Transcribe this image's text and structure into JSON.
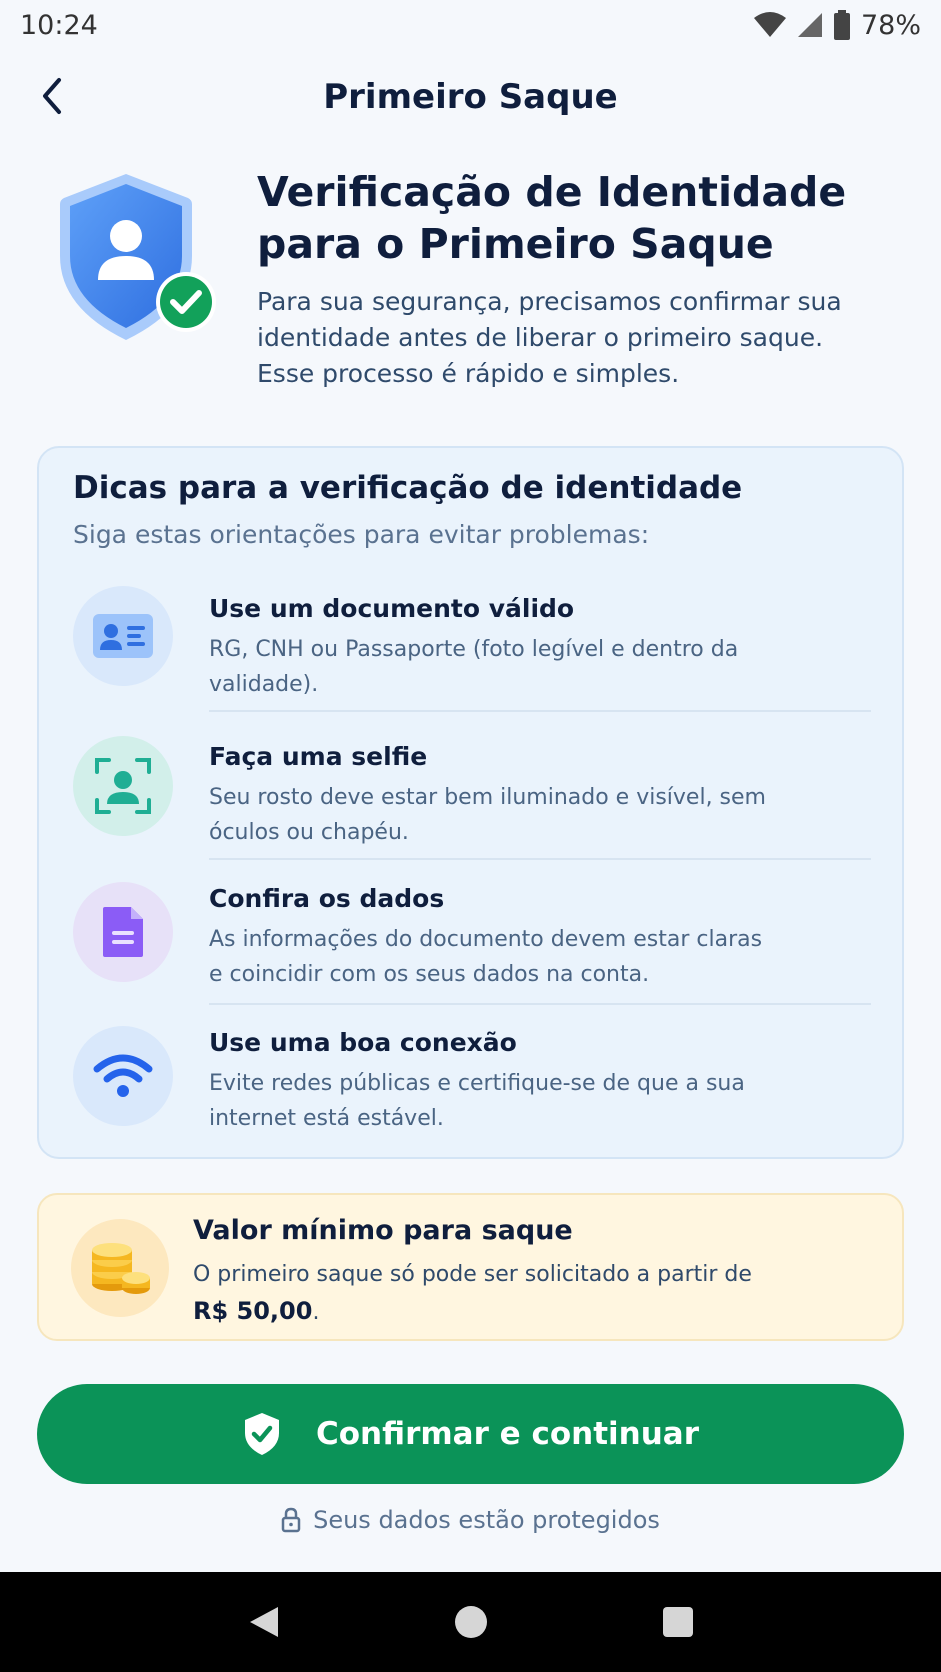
{
  "status_bar": {
    "time": "10:24",
    "battery": "78%"
  },
  "header": {
    "title": "Primeiro Saque"
  },
  "hero": {
    "title": "Verificação de Identidade para o Primeiro Saque",
    "description": "Para sua segurança, precisamos confirmar sua identidade antes de liberar o primeiro saque. Esse processo é rápido e simples."
  },
  "tips": {
    "title": "Dicas para a verificação de identidade",
    "subtitle": "Siga estas orientações para evitar problemas:",
    "items": [
      {
        "title": "Use um documento válido",
        "description": "RG, CNH ou Passaporte (foto legível e dentro da validade).",
        "icon": "id-card-icon",
        "color": "#3b82f6"
      },
      {
        "title": "Faça uma selfie",
        "description": "Seu rosto deve estar bem iluminado e visível, sem óculos ou chapéu.",
        "icon": "selfie-icon",
        "color": "#14b8a6"
      },
      {
        "title": "Confira os dados",
        "description": "As informações do documento devem estar claras e coincidir com os seus dados na conta.",
        "icon": "document-icon",
        "color": "#8b5cf6"
      },
      {
        "title": "Use uma boa conexão",
        "description": "Evite redes públicas e certifique-se de que a sua internet está estável.",
        "icon": "wifi-icon",
        "color": "#2563eb"
      }
    ]
  },
  "minimum": {
    "title": "Valor mínimo para saque",
    "description": "O primeiro saque só pode ser solicitado a partir de",
    "amount": "R$ 50,00",
    "amount_suffix": ".",
    "icon": "coins-icon"
  },
  "confirm_button": {
    "label": "Confirmar e continuar"
  },
  "footer_note": "Seus dados estão protegidos",
  "colors": {
    "primary_green": "#0b9358",
    "accent_blue": "#3b82f6",
    "text_dark": "#0f1e3d"
  }
}
